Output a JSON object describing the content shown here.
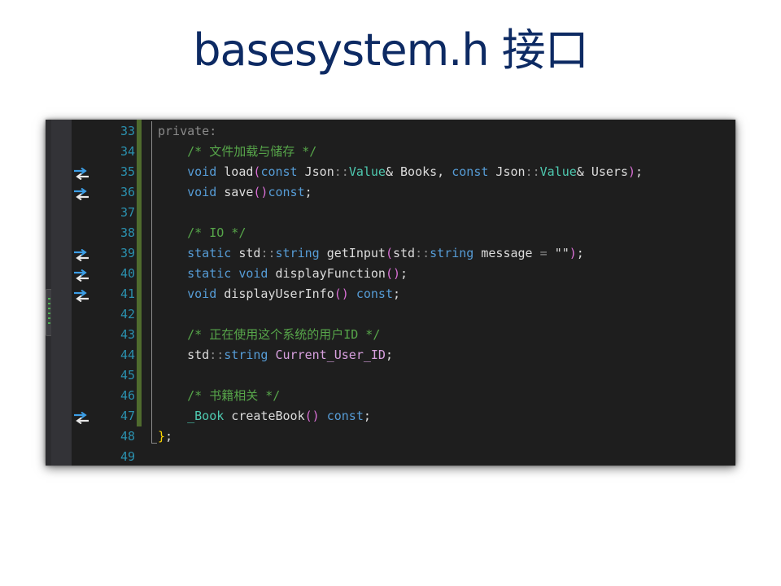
{
  "slide": {
    "title": "basesystem.h 接口"
  },
  "editor": {
    "lines": [
      {
        "num": "33",
        "ref": false,
        "segs": [
          {
            "t": "private",
            "c": "ac"
          },
          {
            "t": ":",
            "c": "ac"
          }
        ]
      },
      {
        "num": "34",
        "ref": false,
        "segs": [
          {
            "t": "    /* 文件加载与储存 */",
            "c": "cm"
          }
        ]
      },
      {
        "num": "35",
        "ref": true,
        "segs": [
          {
            "t": "    ",
            "c": ""
          },
          {
            "t": "void",
            "c": "kw"
          },
          {
            "t": " load",
            "c": "fn"
          },
          {
            "t": "(",
            "c": "br"
          },
          {
            "t": "const",
            "c": "kw"
          },
          {
            "t": " Json",
            "c": "fn"
          },
          {
            "t": "::",
            "c": "ac"
          },
          {
            "t": "Value",
            "c": "ty"
          },
          {
            "t": "& Books, ",
            "c": "fn"
          },
          {
            "t": "const",
            "c": "kw"
          },
          {
            "t": " Json",
            "c": "fn"
          },
          {
            "t": "::",
            "c": "ac"
          },
          {
            "t": "Value",
            "c": "ty"
          },
          {
            "t": "& Users",
            "c": "fn"
          },
          {
            "t": ")",
            "c": "br"
          },
          {
            "t": ";",
            "c": "fn"
          }
        ]
      },
      {
        "num": "36",
        "ref": true,
        "segs": [
          {
            "t": "    ",
            "c": ""
          },
          {
            "t": "void",
            "c": "kw"
          },
          {
            "t": " save",
            "c": "fn"
          },
          {
            "t": "()",
            "c": "br"
          },
          {
            "t": "const",
            "c": "kw"
          },
          {
            "t": ";",
            "c": "fn"
          }
        ]
      },
      {
        "num": "37",
        "ref": false,
        "segs": []
      },
      {
        "num": "38",
        "ref": false,
        "segs": [
          {
            "t": "    /* IO */",
            "c": "cm"
          }
        ]
      },
      {
        "num": "39",
        "ref": true,
        "segs": [
          {
            "t": "    ",
            "c": ""
          },
          {
            "t": "static",
            "c": "kw"
          },
          {
            "t": " std",
            "c": "fn"
          },
          {
            "t": "::",
            "c": "ac"
          },
          {
            "t": "string",
            "c": "kw"
          },
          {
            "t": " getInput",
            "c": "fn"
          },
          {
            "t": "(",
            "c": "br"
          },
          {
            "t": "std",
            "c": "fn"
          },
          {
            "t": "::",
            "c": "ac"
          },
          {
            "t": "string",
            "c": "kw"
          },
          {
            "t": " message ",
            "c": "fn"
          },
          {
            "t": "=",
            "c": "ac"
          },
          {
            "t": " ",
            "c": ""
          },
          {
            "t": "\"\"",
            "c": "fn"
          },
          {
            "t": ")",
            "c": "br"
          },
          {
            "t": ";",
            "c": "fn"
          }
        ]
      },
      {
        "num": "40",
        "ref": true,
        "segs": [
          {
            "t": "    ",
            "c": ""
          },
          {
            "t": "static",
            "c": "kw"
          },
          {
            "t": " ",
            "c": ""
          },
          {
            "t": "void",
            "c": "kw"
          },
          {
            "t": " displayFunction",
            "c": "fn"
          },
          {
            "t": "()",
            "c": "br"
          },
          {
            "t": ";",
            "c": "fn"
          }
        ]
      },
      {
        "num": "41",
        "ref": true,
        "segs": [
          {
            "t": "    ",
            "c": ""
          },
          {
            "t": "void",
            "c": "kw"
          },
          {
            "t": " displayUserInfo",
            "c": "fn"
          },
          {
            "t": "()",
            "c": "br"
          },
          {
            "t": " ",
            "c": ""
          },
          {
            "t": "const",
            "c": "kw"
          },
          {
            "t": ";",
            "c": "fn"
          }
        ]
      },
      {
        "num": "42",
        "ref": false,
        "segs": []
      },
      {
        "num": "43",
        "ref": false,
        "segs": [
          {
            "t": "    /* 正在使用这个系统的用户ID */",
            "c": "cm"
          }
        ]
      },
      {
        "num": "44",
        "ref": false,
        "segs": [
          {
            "t": "    ",
            "c": ""
          },
          {
            "t": "std",
            "c": "fn"
          },
          {
            "t": "::",
            "c": "ac"
          },
          {
            "t": "string",
            "c": "kw"
          },
          {
            "t": " ",
            "c": ""
          },
          {
            "t": "Current_User_ID",
            "c": "id"
          },
          {
            "t": ";",
            "c": "fn"
          }
        ]
      },
      {
        "num": "45",
        "ref": false,
        "segs": []
      },
      {
        "num": "46",
        "ref": false,
        "segs": [
          {
            "t": "    /* 书籍相关 */",
            "c": "cm"
          }
        ]
      },
      {
        "num": "47",
        "ref": true,
        "segs": [
          {
            "t": "    ",
            "c": ""
          },
          {
            "t": "_Book",
            "c": "ty"
          },
          {
            "t": " createBook",
            "c": "fn"
          },
          {
            "t": "()",
            "c": "br"
          },
          {
            "t": " ",
            "c": ""
          },
          {
            "t": "const",
            "c": "kw"
          },
          {
            "t": ";",
            "c": "fn"
          }
        ]
      },
      {
        "num": "48",
        "ref": false,
        "segs": [
          {
            "t": "}",
            "c": "bv"
          },
          {
            "t": ";",
            "c": "fn"
          }
        ]
      },
      {
        "num": "49",
        "ref": false,
        "segs": []
      }
    ]
  },
  "icons": {
    "reference": "go-to-definition-icon"
  },
  "colors": {
    "title": "#0d2a63",
    "editor_bg": "#1e1e1e",
    "keyword": "#569cd6",
    "type": "#4ec9b0",
    "comment": "#57a64a",
    "line_number": "#2b91af",
    "change_bar": "#4f6b2e"
  }
}
